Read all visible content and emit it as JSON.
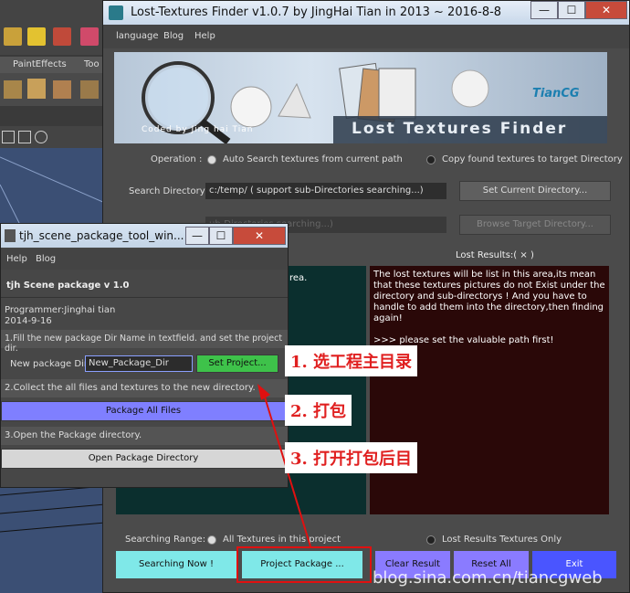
{
  "background": {
    "maya_tabs": [
      "PaintEffects",
      "Too"
    ]
  },
  "main_window": {
    "title": "Lost-Textures Finder v1.0.7 by JingHai Tian in 2013 ~ 2016-8-8",
    "menu": [
      "language",
      "Blog",
      "Help"
    ],
    "banner": {
      "coded_by": "Coded by Jing hai Tian",
      "product": "Lost Textures Finder",
      "logo": "TianCG"
    },
    "operation": {
      "label": "Operation :",
      "option1": "Auto Search textures from current path",
      "option2": "Copy found textures to target Directory"
    },
    "search_dir": {
      "label": "Search Directory:",
      "value": "c:/temp/ ( support sub-Directories searching...)",
      "button": "Set Current Directory..."
    },
    "target_dir": {
      "value_partial": "ub-Directories searching...)",
      "button": "Browse Target Directory..."
    },
    "lost_results_header": "Lost Results:( × )",
    "left_pane_fragment": "rea.",
    "lost_results_text": "The lost textures will be list in this area,its mean that these textures pictures do not Exist under the directory and sub-directorys ! And you have to handle to add them into the directory,then finding again!",
    "lost_results_text2": ">>> please set the valuable path first!",
    "searching_range": {
      "label": "Searching Range:",
      "option1": "All Textures in this project",
      "option2": "Lost Results Textures Only"
    },
    "buttons": {
      "searching_now": "Searching  Now !",
      "project_package": "Project Package ...",
      "clear_result": "Clear Result",
      "reset_all": "Reset All",
      "exit": "Exit"
    }
  },
  "package_window": {
    "title": "tjh_scene_package_tool_win...",
    "menu": [
      "Help",
      "Blog"
    ],
    "heading": "tjh Scene package v 1.0",
    "programmer": "Programmer:Jinghai tian",
    "date": "2014-9-16",
    "step1": "1.Fill the new package Dir Name in textfield. and set the project dir.",
    "dir_label": "New package Dir :",
    "dir_value": "New_Package_Dir",
    "set_project": "Set Project...",
    "step2": "2.Collect the all files and textures to the new directory.",
    "package_all": "Package  All  Files",
    "step3": "3.Open the Package directory.",
    "open_dir": "Open Package Directory"
  },
  "annotations": {
    "a1": "1. 选工程主目录",
    "a2": "2. 打包",
    "a3": "3. 打开打包后目"
  },
  "watermark": "blog.sina.com.cn/tiancgweb",
  "colors": {
    "cyan_button": "#7fe8e8",
    "purple_button": "#8a7bff",
    "blue_button": "#4a55ff",
    "green_button": "#3ec24a",
    "highlight_red": "#e01010"
  }
}
